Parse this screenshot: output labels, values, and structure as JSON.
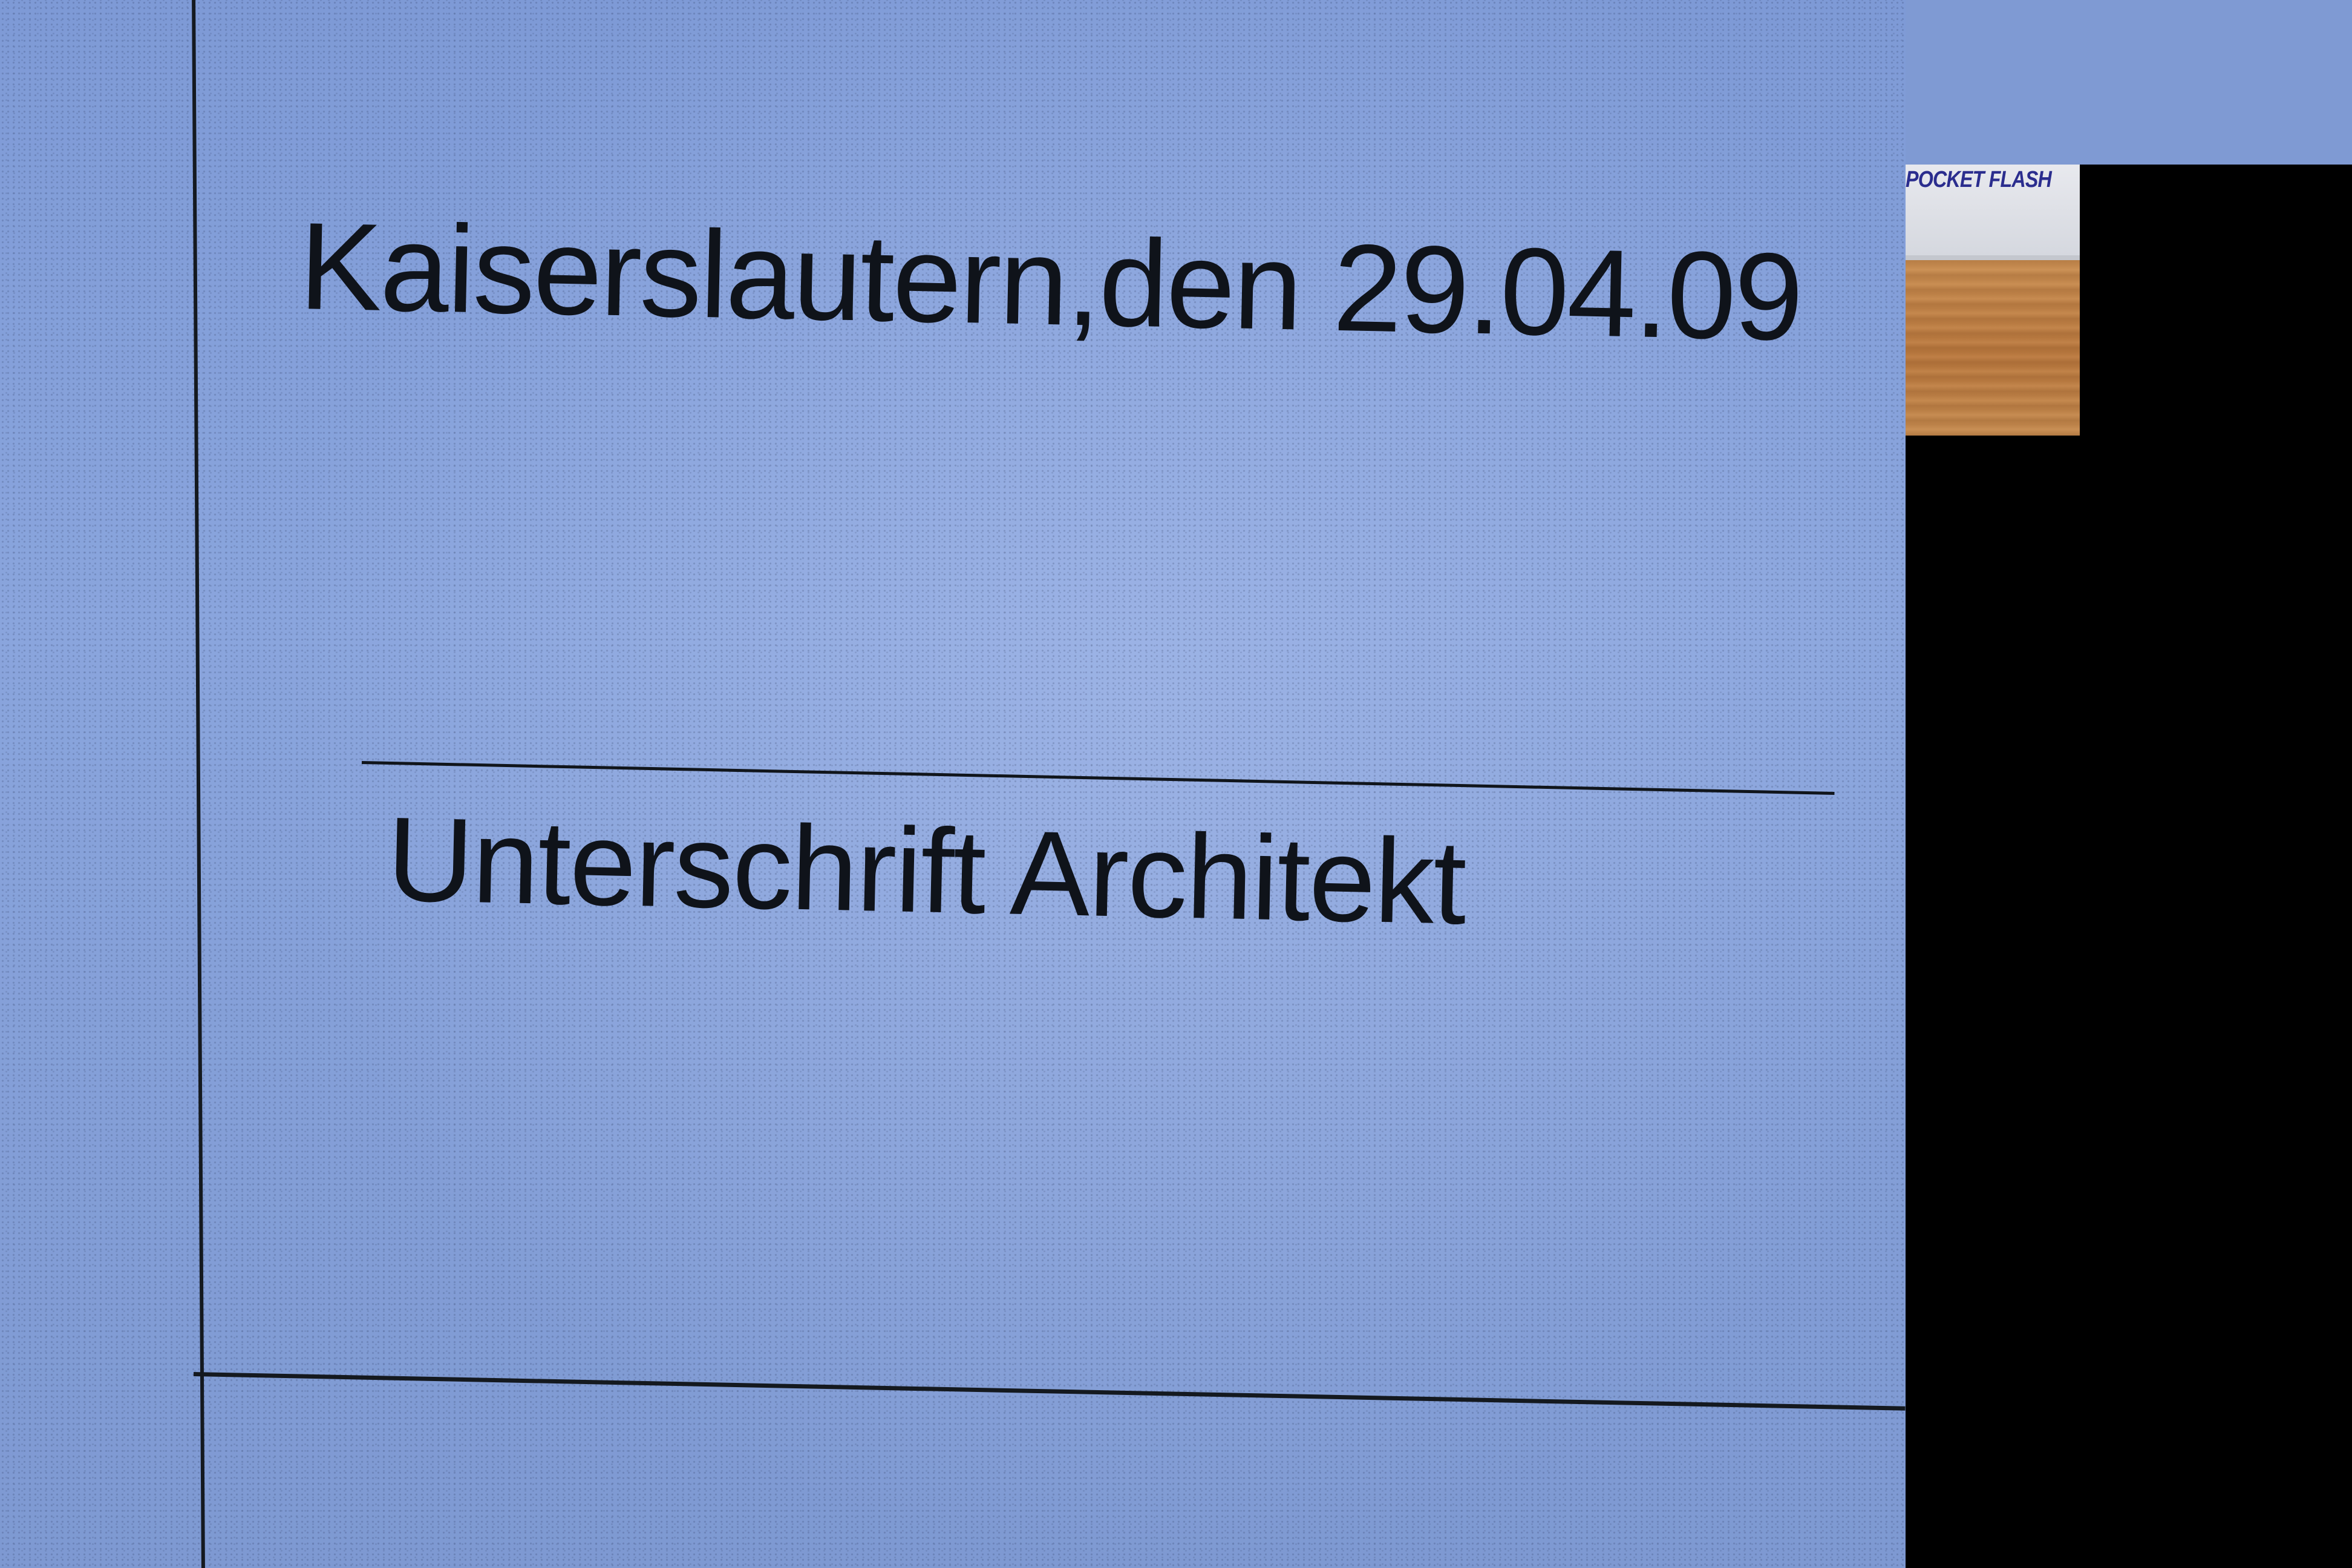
{
  "document_photo": {
    "date_line": "Kaiserslautern,den 29.04.09",
    "signature_caption": "Unterschrift Architekt"
  },
  "inset_photo": {
    "title": "POCKET FLASH"
  }
}
